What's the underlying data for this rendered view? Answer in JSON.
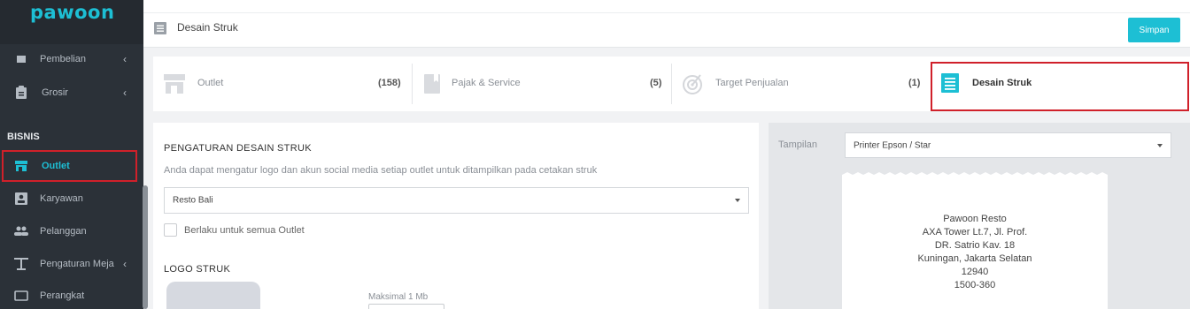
{
  "brand": {
    "logo_text": "pawoon"
  },
  "sidebar": {
    "items": [
      {
        "label": "Pembelian",
        "icon": "cart-icon"
      },
      {
        "label": "Grosir",
        "icon": "clipboard-icon"
      },
      {
        "label": "Outlet",
        "icon": "store-icon"
      },
      {
        "label": "Karyawan",
        "icon": "id-card-icon"
      },
      {
        "label": "Pelanggan",
        "icon": "users-icon"
      },
      {
        "label": "Pengaturan Meja",
        "icon": "table-icon"
      },
      {
        "label": "Perangkat",
        "icon": "device-icon"
      }
    ],
    "section_bisnis": "BISNIS"
  },
  "header": {
    "title": "Desain Struk",
    "save_label": "Simpan"
  },
  "tabs": [
    {
      "label": "Outlet",
      "count": "(158)",
      "icon": "store-icon"
    },
    {
      "label": "Pajak & Service",
      "count": "(5)",
      "icon": "bookmark-icon"
    },
    {
      "label": "Target Penjualan",
      "count": "(1)",
      "icon": "target-icon"
    },
    {
      "label": "Desain Struk",
      "count": "",
      "icon": "receipt-icon"
    }
  ],
  "settings": {
    "title": "PENGATURAN DESAIN STRUK",
    "description": "Anda dapat mengatur logo dan akun social media setiap outlet untuk ditampilkan pada cetakan struk",
    "outlet_select": "Resto Bali",
    "apply_all_label": "Berlaku untuk semua Outlet",
    "logo_title": "LOGO STRUK",
    "max_size_label": "Maksimal 1 Mb"
  },
  "preview": {
    "display_label": "Tampilan",
    "printer_select": "Printer Epson / Star",
    "receipt_lines": [
      "Pawoon Resto",
      "AXA Tower Lt.7, Jl. Prof.",
      "DR. Satrio Kav. 18",
      "Kuningan, Jakarta Selatan",
      "12940",
      "1500-360"
    ]
  },
  "colors": {
    "accent": "#1dbfd4",
    "highlight": "#d0202a",
    "sidebar_bg": "#2b3138"
  }
}
